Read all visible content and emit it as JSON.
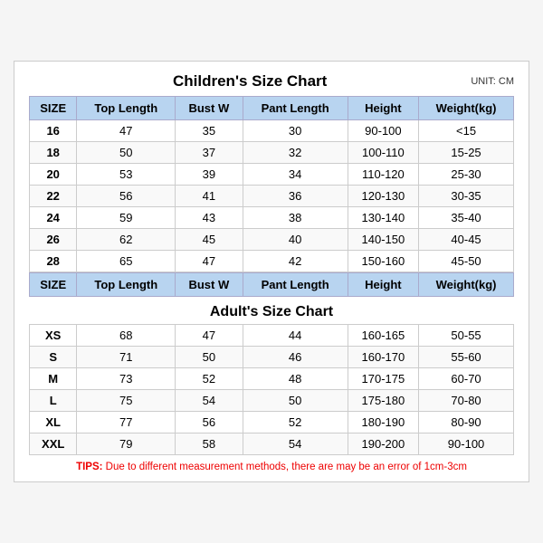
{
  "mainTitle": "Children's Size Chart",
  "unitLabel": "UNIT: CM",
  "childrenHeaders": [
    "SIZE",
    "Top Length",
    "Bust W",
    "Pant Length",
    "Height",
    "Weight(kg)"
  ],
  "childrenRows": [
    [
      "16",
      "47",
      "35",
      "30",
      "90-100",
      "<15"
    ],
    [
      "18",
      "50",
      "37",
      "32",
      "100-110",
      "15-25"
    ],
    [
      "20",
      "53",
      "39",
      "34",
      "110-120",
      "25-30"
    ],
    [
      "22",
      "56",
      "41",
      "36",
      "120-130",
      "30-35"
    ],
    [
      "24",
      "59",
      "43",
      "38",
      "130-140",
      "35-40"
    ],
    [
      "26",
      "62",
      "45",
      "40",
      "140-150",
      "40-45"
    ],
    [
      "28",
      "65",
      "47",
      "42",
      "150-160",
      "45-50"
    ]
  ],
  "adultTitle": "Adult's Size Chart",
  "adultHeaders": [
    "SIZE",
    "Top Length",
    "Bust W",
    "Pant Length",
    "Height",
    "Weight(kg)"
  ],
  "adultRows": [
    [
      "XS",
      "68",
      "47",
      "44",
      "160-165",
      "50-55"
    ],
    [
      "S",
      "71",
      "50",
      "46",
      "160-170",
      "55-60"
    ],
    [
      "M",
      "73",
      "52",
      "48",
      "170-175",
      "60-70"
    ],
    [
      "L",
      "75",
      "54",
      "50",
      "175-180",
      "70-80"
    ],
    [
      "XL",
      "77",
      "56",
      "52",
      "180-190",
      "80-90"
    ],
    [
      "XXL",
      "79",
      "58",
      "54",
      "190-200",
      "90-100"
    ]
  ],
  "tipsLabel": "TIPS:",
  "tipsText": " Due to different measurement methods, there are may be an error of 1cm-3cm"
}
